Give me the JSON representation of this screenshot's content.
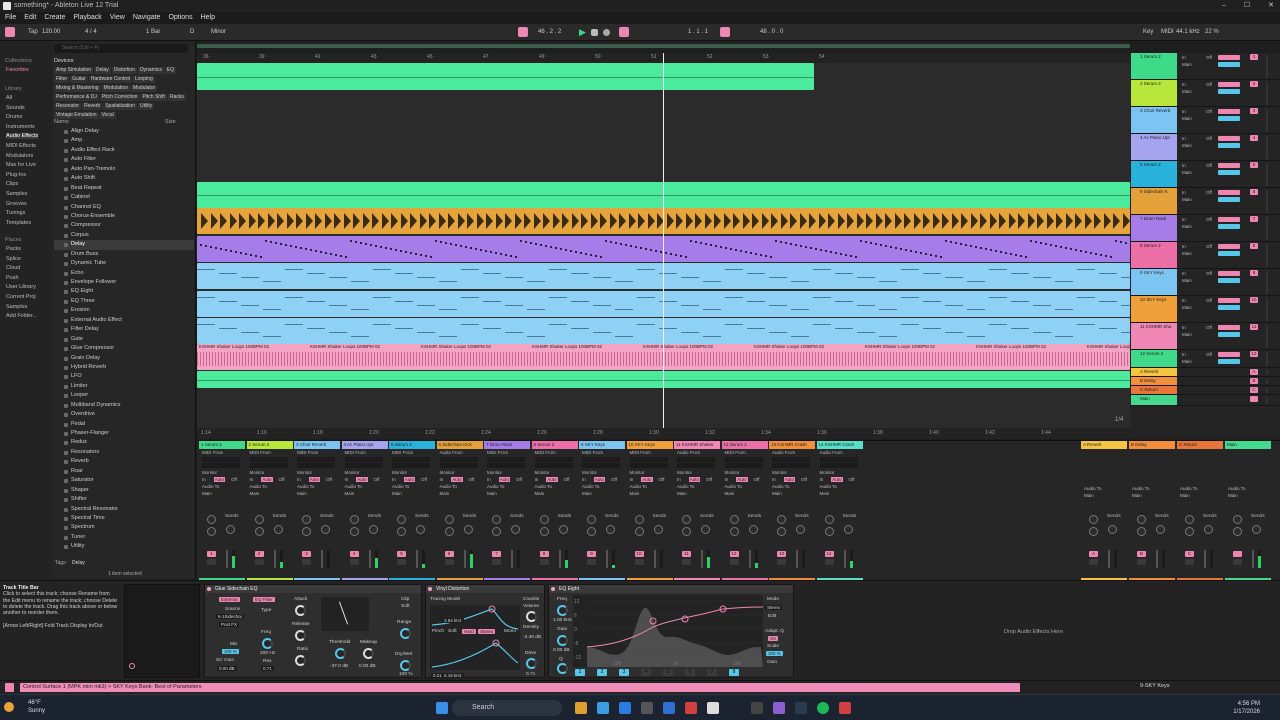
{
  "window": {
    "title": "something* - Ableton Live 12 Trial",
    "controls": [
      "–",
      "☐",
      "✕"
    ]
  },
  "menu": [
    "File",
    "Edit",
    "Create",
    "Playback",
    "View",
    "Navigate",
    "Options",
    "Help"
  ],
  "transport": {
    "tap": "Tap",
    "tempo": "120.00",
    "signature": "4 / 4",
    "quantize": "1 Bar",
    "key": "D",
    "scale": "Minor",
    "position": "46 . 2 . 2",
    "loop_start": "1 . 1 . 1",
    "loop_length": "48 . 0 . 0",
    "key_label": "Key",
    "midi_label": "MIDI",
    "sample_rate": "44.1 kHz",
    "cpu": "22 %"
  },
  "browser": {
    "search_placeholder": "Search (Ctrl + F)",
    "collections_head": "Collections",
    "favorites": "Favorites",
    "library_head": "Library",
    "library": [
      "All",
      "Sounds",
      "Drums",
      "Instruments",
      "Audio Effects",
      "MIDI Effects",
      "Modulators",
      "Max for Live",
      "Plug-Ins",
      "Clips",
      "Samples",
      "Grooves",
      "Tunings",
      "Templates"
    ],
    "places_head": "Places",
    "places": [
      "Packs",
      "Splice",
      "Cloud",
      "Push",
      "User Library",
      "Current Proj",
      "Samples",
      "Add Folder..."
    ],
    "devices_label": "Devices",
    "tags": [
      "Amp Simulation",
      "Delay",
      "Distortion",
      "Dynamics",
      "EQ",
      "Filter",
      "Guitar",
      "Hardware Control",
      "Looping",
      "Mixing & Mastering",
      "Modulation",
      "Modulator",
      "Performance & DJ",
      "Pitch Correction",
      "Pitch Shift",
      "Racks",
      "Resonator",
      "Reverb",
      "Spatialization",
      "Utility",
      "Vintage Emulation",
      "Vocal"
    ],
    "col_name": "Name",
    "col_size": "Size",
    "items": [
      "Align Delay",
      "Amp",
      "Audio Effect Rack",
      "Auto Filter",
      "Auto Pan-Tremolo",
      "Auto Shift",
      "Beat Repeat",
      "Cabinet",
      "Channel EQ",
      "Chorus-Ensemble",
      "Compressor",
      "Corpus",
      "Delay",
      "Drum Buss",
      "Dynamic Tube",
      "Echo",
      "Envelope Follower",
      "EQ Eight",
      "EQ Three",
      "Erosion",
      "External Audio Effect",
      "Filter Delay",
      "Gate",
      "Glue Compressor",
      "Grain Delay",
      "Hybrid Reverb",
      "LFO",
      "Limiter",
      "Looper",
      "Multiband Dynamics",
      "Overdrive",
      "Pedal",
      "Phaser-Flanger",
      "Redux",
      "Resonators",
      "Reverb",
      "Roar",
      "Saturator",
      "Shaper",
      "Shifter",
      "Spectral Resonator",
      "Spectral Time",
      "Spectrum",
      "Tuner",
      "Utility"
    ],
    "selected_item": "Delay",
    "footer_tags": "Tags:",
    "footer_tag": "Delay",
    "footer_selected": "1 item selected"
  },
  "arrangement": {
    "ruler": [
      "36",
      "39",
      "41",
      "43",
      "45",
      "47",
      "49",
      "50",
      "51",
      "52",
      "53",
      "54"
    ],
    "ruler_labels": [
      "38",
      "40",
      "42",
      "44",
      "46",
      "48"
    ],
    "timeline": [
      "1:14",
      "1:16",
      "1:18",
      "1:20",
      "1:22",
      "1:24",
      "1:26",
      "1:28",
      "1:30",
      "1:32",
      "1:34",
      "1:36",
      "1:38",
      "1:40",
      "1:42",
      "1:44"
    ],
    "zoom_label": "1/4",
    "clip_label": "KSHMR Shaker Loops 100BPM 02"
  },
  "tracks": [
    {
      "name": "1 Serum 2",
      "color": "#3fd98a",
      "num": "1"
    },
    {
      "name": "2 Serum 2",
      "color": "#b9e63a",
      "num": "2"
    },
    {
      "name": "3 Choir Reverb",
      "color": "#7cc5f2",
      "num": "3"
    },
    {
      "name": "4 Ac Piano Upr",
      "color": "#a6a4ef",
      "num": "4"
    },
    {
      "name": "5 Serum 2",
      "color": "#29b3dc",
      "num": "5"
    },
    {
      "name": "6 Sidechain K",
      "color": "#e4a13a",
      "num": "6"
    },
    {
      "name": "7 Drum Rack",
      "color": "#a57ce8",
      "num": "7"
    },
    {
      "name": "8 Serum 2",
      "color": "#ec6fa8",
      "num": "8"
    },
    {
      "name": "9 SKY Keys",
      "color": "#7cc5f2",
      "num": "9"
    },
    {
      "name": "10 SKY Keys",
      "color": "#f0a03a",
      "num": "10"
    },
    {
      "name": "11 KSHMR Sha",
      "color": "#f187b4",
      "num": "11"
    },
    {
      "name": "12 Serum 2",
      "color": "#3fd98a",
      "num": "12"
    },
    {
      "name": "A Reverb",
      "color": "#f5c542",
      "num": "A"
    },
    {
      "name": "B Delay",
      "color": "#f28f3b",
      "num": "B"
    },
    {
      "name": "C Return",
      "color": "#e8753a",
      "num": "C"
    },
    {
      "name": "Main",
      "color": "#45d98d",
      "num": ""
    }
  ],
  "track_controls": {
    "in": "In",
    "auto": "Auto",
    "off": "Off",
    "main": "Main",
    "sends": "Sends",
    "midi_from": "MIDI From",
    "audio_from": "Audio From",
    "all_ins": "All Ins",
    "all_channels": "All Channels",
    "ext_in": "Ext. In",
    "monitor": "Monitor",
    "audio_to": "Audio To",
    "cue_out": "Cue Out",
    "main_out": "Main Out",
    "cue_val": "ii 1/2",
    "main_val": "ii 1/2"
  },
  "mixer_strips": [
    {
      "name": "1 Serum 2",
      "color": "#3fd98a",
      "input": "MIDI From",
      "num": "1"
    },
    {
      "name": "2 Serum 2",
      "color": "#b9e63a",
      "input": "MIDI From",
      "num": "2"
    },
    {
      "name": "3 Choir Reverb",
      "color": "#7cc5f2",
      "input": "MIDI From",
      "num": "3"
    },
    {
      "name": "4 Ac Piano Upr",
      "color": "#a6a4ef",
      "input": "MIDI From",
      "num": "4"
    },
    {
      "name": "5 Serum 2",
      "color": "#29b3dc",
      "input": "MIDI From",
      "num": "5"
    },
    {
      "name": "6 Sidechain Kick",
      "color": "#e4a13a",
      "input": "Audio From",
      "num": "6"
    },
    {
      "name": "7 Drum Rack",
      "color": "#a57ce8",
      "input": "MIDI From",
      "num": "7"
    },
    {
      "name": "8 Serum 2",
      "color": "#ec6fa8",
      "input": "MIDI From",
      "num": "8"
    },
    {
      "name": "9 SKY Keys",
      "color": "#7cc5f2",
      "input": "MIDI From",
      "num": "9"
    },
    {
      "name": "10 SKY Keys",
      "color": "#f0a03a",
      "input": "MIDI From",
      "num": "10"
    },
    {
      "name": "11 KSHMR Shaker",
      "color": "#f187b4",
      "input": "Audio From",
      "num": "11"
    },
    {
      "name": "12 Serum 2",
      "color": "#ec6fa8",
      "input": "MIDI From",
      "num": "12"
    },
    {
      "name": "13 KSHMR Crash",
      "color": "#f28f3b",
      "input": "Audio From",
      "num": "13"
    },
    {
      "name": "14 KSHMR Crash",
      "color": "#56e0c8",
      "input": "Audio From",
      "num": "14"
    }
  ],
  "return_strips": [
    {
      "name": "A Reverb",
      "color": "#f5c542",
      "num": "A"
    },
    {
      "name": "B Delay",
      "color": "#f28f3b",
      "num": "B"
    },
    {
      "name": "C Return",
      "color": "#e8753a",
      "num": "C"
    },
    {
      "name": "Main",
      "color": "#45d98d",
      "num": ""
    }
  ],
  "info_panel": {
    "title": "Track Title Bar",
    "body": "Click to select this track; choose Rename from the Edit menu to rename the track; choose Delete to delete the track. Drag this track above or below another to reorder them.",
    "hint": "[Arrow Left/Right] Fold Track Display In/Out"
  },
  "devices": {
    "glue": {
      "title": "Glue Sidechain EQ",
      "external": "External",
      "eq": "EQ Filter",
      "source_label": "Source",
      "source": "6-1Sidechai",
      "post": "Post FX",
      "type_label": "Type",
      "freq_label": "Freq",
      "freq": "200 Hz",
      "mix_label": "Mix",
      "mix": "100 %",
      "attack": "Attack",
      "release": "Release",
      "ratio": "Ratio",
      "threshold": "Threshold",
      "makeup": "Makeup",
      "thr_val": "-37.0 dB",
      "mk_val": "0.00 dB",
      "range": "Range",
      "drywet": "Dry/Wet",
      "clip": "Clip",
      "soft": "Soft",
      "sc_gain": "SC Gain",
      "gain_val": "0.00 dB",
      "res": "Res",
      "res_val": "0.71",
      "drywet_val": "100 %"
    },
    "vinyl": {
      "title": "Vinyl Distortion",
      "tracing": "Tracing Model",
      "crackle": "Crackle",
      "volume": "Volume",
      "density": "Density",
      "pinch": "Pinch",
      "soft": "Soft",
      "mono": "Mono",
      "drive": "Drive",
      "freq1": "3.94 kHz",
      "freq2": "5.19 kHz",
      "q_val": "0.21",
      "hard": "Hard",
      "stereo": "Stereo",
      "vol_val": "0.00 dB",
      "den_val": "0.00",
      "drv_val": "0.71",
      "db_val": "-2.40 dB"
    },
    "eq8": {
      "title": "EQ Eight",
      "freq_label": "Freq",
      "gain_label": "Gain",
      "q_label": "Q",
      "mode": "Mode",
      "stereo": "Stereo",
      "edit": "Edit",
      "adapt": "Adapt. Q",
      "on": "On",
      "scale": "Scale",
      "scale_val": "100 %",
      "gain_out": "Gain",
      "freq_val": "1.00 kHz",
      "gain_val": "0.00 dB",
      "q_val": "0.71",
      "bands": [
        "1",
        "2",
        "3",
        "4",
        "5",
        "6",
        "7",
        "8"
      ],
      "axis": [
        "100",
        "1k",
        "10k"
      ],
      "db": [
        "12",
        "6",
        "0",
        "-6",
        "-12"
      ]
    },
    "drop_hint": "Drop Audio Effects Here"
  },
  "status": {
    "message": "Control Surface 1 (MPK mini mk3) > SKY Keys Bank: Best of Parameters",
    "track": "9-SKY Keys"
  },
  "taskbar": {
    "temp": "46°F",
    "weather": "Sunny",
    "search": "Search",
    "time": "4:56 PM",
    "date": "1/17/2026"
  }
}
